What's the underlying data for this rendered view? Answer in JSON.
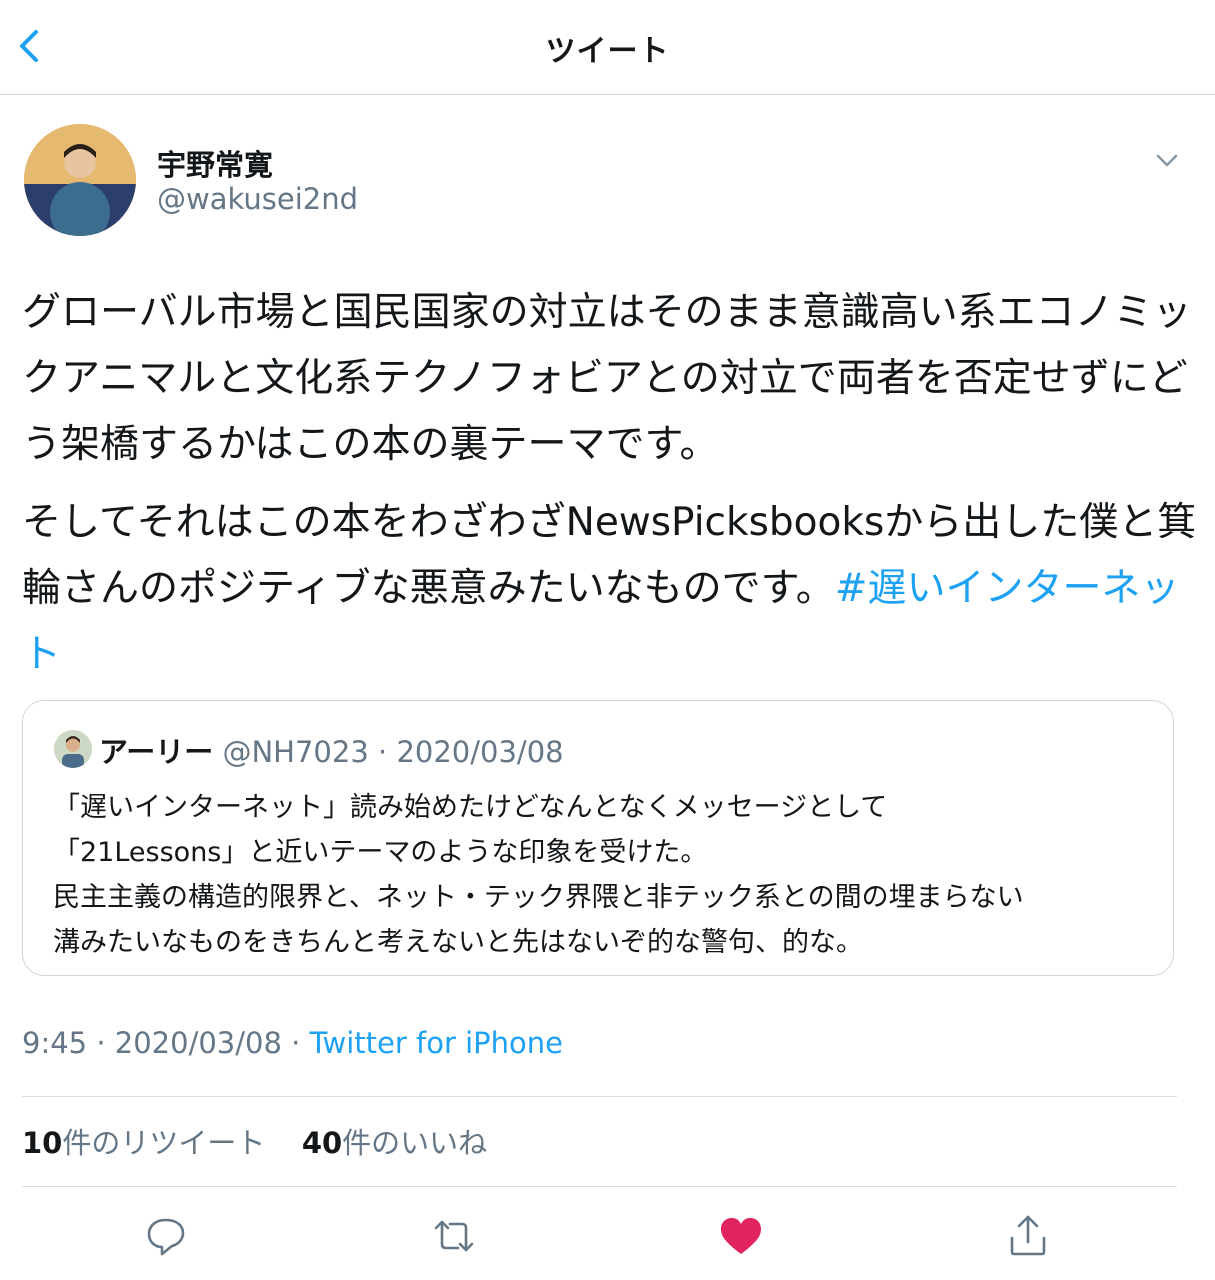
{
  "header": {
    "title": "ツイート"
  },
  "tweet": {
    "author_name": "宇野常寛",
    "author_handle": "@wakusei2nd",
    "paragraph1": "グローバル市場と国民国家の対立はそのまま意識高い系エコノミックアニマルと文化系テクノフォビアとの対立で両者を否定せずにどう架橋するかはこの本の裏テーマです。",
    "paragraph2": "そしてそれはこの本をわざわざNewsPicksbooksから出した僕と箕輪さんのポジティブな悪意みたいなものです。",
    "hashtag": "#遅いインターネット"
  },
  "quote": {
    "name": "アーリー",
    "handle": "@NH7023",
    "date": "2020/03/08",
    "lines": [
      "「遅いインターネット」読み始めたけどなんとなくメッセージとして",
      "「21Lessons」と近いテーマのような印象を受けた。",
      "民主主義の構造的限界と、ネット・テック界隈と非テック系との間の埋まらない",
      "溝みたいなものをきちんと考えないと先はないぞ的な警句、的な。"
    ]
  },
  "meta": {
    "time": "9:45",
    "date": "2020/03/08",
    "source": "Twitter for iPhone"
  },
  "stats": {
    "retweets": "10",
    "retweets_label": "件のリツイート",
    "likes": "40",
    "likes_label": "件のいいね"
  },
  "colors": {
    "accent": "#1da1f2",
    "like": "#e0245e",
    "muted": "#657786",
    "text": "#14171a"
  },
  "actions": [
    "reply-icon",
    "retweet-icon",
    "like-icon",
    "share-icon"
  ]
}
